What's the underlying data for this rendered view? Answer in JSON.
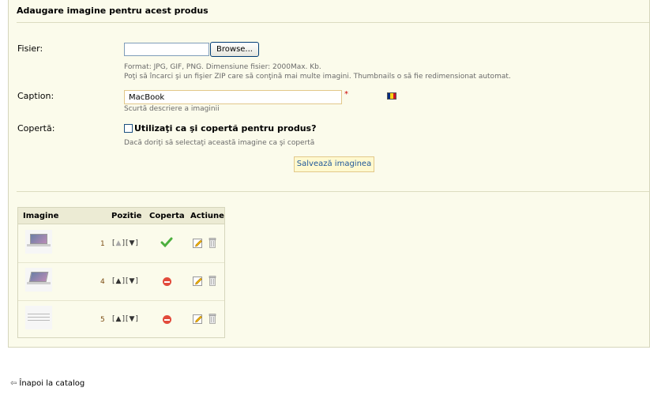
{
  "panel": {
    "title": "Adaugare imagine pentru acest produs"
  },
  "form": {
    "file_label": "Fisier:",
    "browse_label": "Browse...",
    "file_hint_1": "Format: JPG, GIF, PNG. Dimensiune fisier: 2000Max. Kb.",
    "file_hint_2": "Poţi să încarci şi un fişier ZIP care să conţină mai multe imagini. Thumbnails o să fie redimensionat automat.",
    "caption_label": "Caption:",
    "caption_value": "MacBook",
    "required_mark": "*",
    "caption_hint": "Scurtă descriere a imaginii",
    "cover_label": "Copertă:",
    "cover_checkbox_label": "Utilizaţi ca şi copertă pentru produs?",
    "cover_hint": "Dacă doriţi să selectaţi această imagine ca şi copertă",
    "save_label": "Salvează imaginea",
    "flag_colors": [
      "#002b7f",
      "#fcd116",
      "#ce1126"
    ]
  },
  "table": {
    "headers": {
      "image": "Imagine",
      "position": "Pozitie",
      "cover": "Coperta",
      "action": "Actiune"
    },
    "rows": [
      {
        "position": "1",
        "up": "▲",
        "down": "▼",
        "up_enabled": false,
        "is_cover": true,
        "thumb": "laptop-open"
      },
      {
        "position": "4",
        "up": "▲",
        "down": "▼",
        "up_enabled": true,
        "is_cover": false,
        "thumb": "laptop-angle"
      },
      {
        "position": "5",
        "up": "▲",
        "down": "▼",
        "up_enabled": true,
        "is_cover": false,
        "thumb": "laptop-side"
      }
    ]
  },
  "footer": {
    "back_label": "Înapoi la catalog",
    "back_icon": "left-arrow-icon"
  }
}
